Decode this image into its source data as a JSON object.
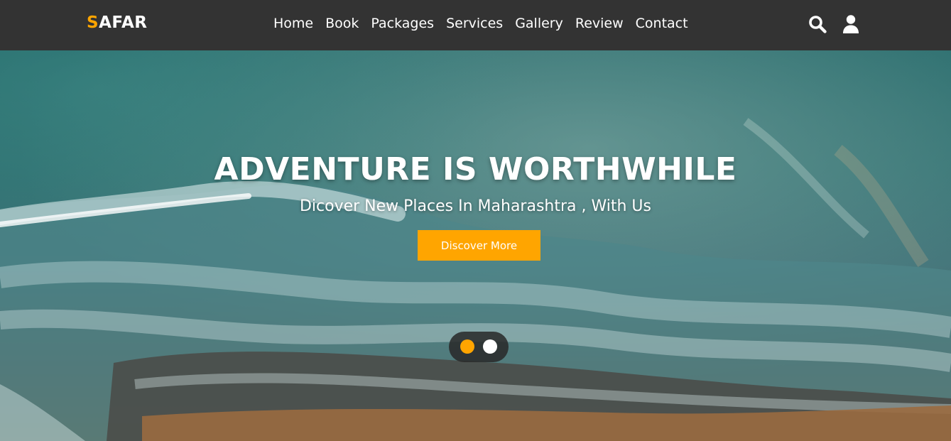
{
  "brand": {
    "first_letter": "S",
    "rest": "AFAR",
    "accent_color": "#ffa500"
  },
  "nav": {
    "items": [
      {
        "label": "Home"
      },
      {
        "label": "Book"
      },
      {
        "label": "Packages"
      },
      {
        "label": "Services"
      },
      {
        "label": "Gallery"
      },
      {
        "label": "Review"
      },
      {
        "label": "Contact"
      }
    ],
    "icons": [
      "search-icon",
      "user-icon"
    ]
  },
  "hero": {
    "title": "ADVENTURE IS WORTHWHILE",
    "subtitle": "Dicover New Places In Maharashtra , With Us",
    "button_label": "Discover More",
    "slides_total": 2,
    "active_slide": 1
  },
  "colors": {
    "navbar": "#333333",
    "accent": "#ffa500",
    "text": "#ffffff"
  }
}
